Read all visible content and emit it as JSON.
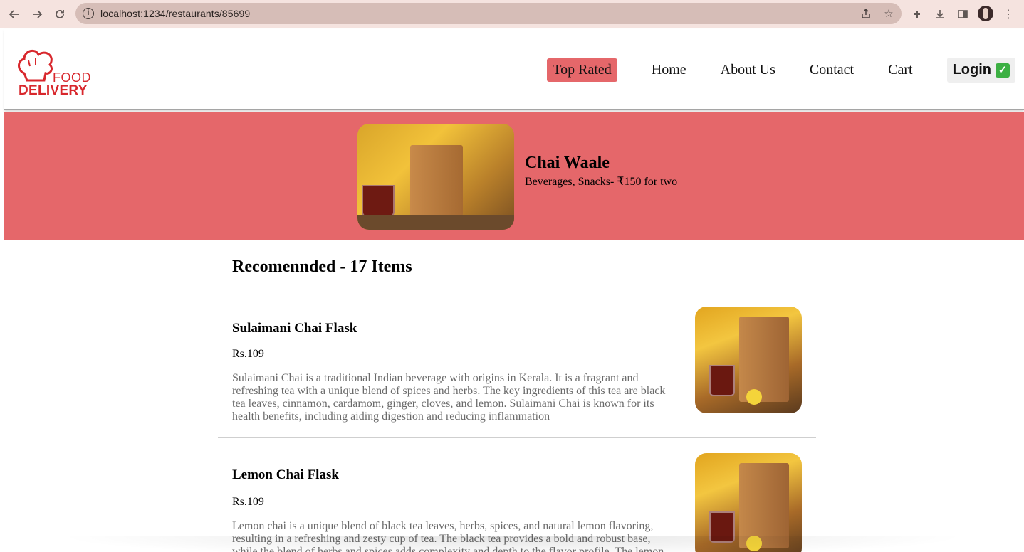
{
  "browser": {
    "url": "localhost:1234/restaurants/85699"
  },
  "header": {
    "logo": {
      "line1": "FOOD",
      "line2": "DELIVERY"
    },
    "nav": {
      "top_rated": "Top Rated",
      "home": "Home",
      "about": "About Us",
      "contact": "Contact",
      "cart": "Cart",
      "login": "Login"
    },
    "accent_color": "#e5676a"
  },
  "restaurant": {
    "name": "Chai Waale",
    "meta": "Beverages, Snacks- ₹150 for two"
  },
  "menu": {
    "title": "Recomennded - 17 Items",
    "items": [
      {
        "name": "Sulaimani Chai Flask",
        "price": "Rs.109",
        "description": "Sulaimani Chai is a traditional Indian beverage with origins in Kerala. It is a fragrant and refreshing tea with a unique blend of spices and herbs. The key ingredients of this tea are black tea leaves, cinnamon, cardamom, ginger, cloves, and lemon. Sulaimani Chai is known for its health benefits, including aiding digestion and reducing inflammation"
      },
      {
        "name": "Lemon Chai Flask",
        "price": "Rs.109",
        "description": "Lemon chai is a unique blend of black tea leaves, herbs, spices, and natural lemon flavoring, resulting in a refreshing and zesty cup of tea. The black tea provides a bold and robust base, while the blend of herbs and spices adds complexity and depth to the flavor profile. The lemon"
      }
    ]
  }
}
